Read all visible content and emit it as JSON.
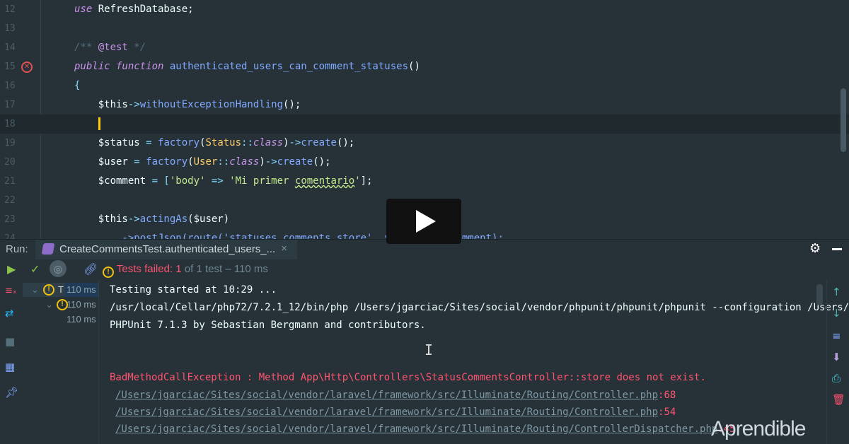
{
  "editor": {
    "lines": [
      {
        "n": "12",
        "tokens": [
          [
            "use ",
            "kw"
          ],
          [
            "RefreshDatabase;",
            "var"
          ]
        ]
      },
      {
        "n": "13",
        "tokens": []
      },
      {
        "n": "14",
        "tokens": [
          [
            "/** ",
            "cm"
          ],
          [
            "@test",
            "tag"
          ],
          [
            " */",
            "cm"
          ]
        ]
      },
      {
        "n": "15",
        "tokens": [
          [
            "public function ",
            "kw"
          ],
          [
            "authenticated_users_can_comment_statuses",
            "fn"
          ],
          [
            "()",
            "var"
          ]
        ]
      },
      {
        "n": "16",
        "tokens": [
          [
            "{",
            "op"
          ]
        ]
      },
      {
        "n": "17",
        "tokens": [
          [
            "    $this",
            "var"
          ],
          [
            "->",
            "op"
          ],
          [
            "withoutExceptionHandling",
            "fn"
          ],
          [
            "();",
            "var"
          ]
        ]
      },
      {
        "n": "18",
        "tokens": [
          [
            "    ",
            "var"
          ]
        ],
        "caret": true
      },
      {
        "n": "19",
        "tokens": [
          [
            "    $status ",
            "var"
          ],
          [
            "= ",
            "op"
          ],
          [
            "factory",
            "fn"
          ],
          [
            "(",
            "var"
          ],
          [
            "Status",
            "cls"
          ],
          [
            "::",
            "op"
          ],
          [
            "class",
            "it"
          ],
          [
            ")",
            "var"
          ],
          [
            "->",
            "op"
          ],
          [
            "create",
            "fn"
          ],
          [
            "();",
            "var"
          ]
        ]
      },
      {
        "n": "20",
        "tokens": [
          [
            "    $user ",
            "var"
          ],
          [
            "= ",
            "op"
          ],
          [
            "factory",
            "fn"
          ],
          [
            "(",
            "var"
          ],
          [
            "User",
            "cls"
          ],
          [
            "::",
            "op"
          ],
          [
            "class",
            "it"
          ],
          [
            ")",
            "var"
          ],
          [
            "->",
            "op"
          ],
          [
            "create",
            "fn"
          ],
          [
            "();",
            "var"
          ]
        ]
      },
      {
        "n": "21",
        "tokens": [
          [
            "    $comment ",
            "var"
          ],
          [
            "= [",
            "op"
          ],
          [
            "'body'",
            "str"
          ],
          [
            " => ",
            "op"
          ],
          [
            "'Mi primer ",
            "str"
          ],
          [
            "comentario",
            "str sq"
          ],
          [
            "'",
            "str"
          ],
          [
            "];",
            "var"
          ]
        ]
      },
      {
        "n": "22",
        "tokens": []
      },
      {
        "n": "23",
        "tokens": [
          [
            "    $this",
            "var"
          ],
          [
            "->",
            "op"
          ],
          [
            "actingAs",
            "fn"
          ],
          [
            "($user)",
            "var"
          ]
        ]
      },
      {
        "n": "24",
        "tokens": [
          [
            "        ->postJson(route('statuses.comments.store', $status), $comment);",
            "fn"
          ]
        ]
      }
    ]
  },
  "run": {
    "label": "Run:",
    "tab": "CreateCommentsTest.authenticated_users_...",
    "close": "×",
    "status_failed": "Tests failed: 1",
    "status_rest": " of 1 test – 110 ms"
  },
  "tree": [
    {
      "label": "T",
      "time": "110 ms"
    },
    {
      "label": "",
      "time": "110 ms"
    },
    {
      "label": "",
      "time": "110 ms"
    }
  ],
  "console": {
    "lines": [
      "Testing started at 10:29 ...",
      "/usr/local/Cellar/php72/7.2.1_12/bin/php /Users/jgarciac/Sites/social/vendor/phpunit/phpunit/phpunit --configuration /Users/",
      "PHPUnit 7.1.3 by Sebastian Bergmann and contributors."
    ],
    "error": "BadMethodCallException : Method App\\Http\\Controllers\\StatusCommentsController::store does not exist.",
    "trace": [
      {
        "path": "/Users/jgarciac/Sites/social/vendor/laravel/framework/src/Illuminate/Routing/Controller.php",
        "line": ":68"
      },
      {
        "path": "/Users/jgarciac/Sites/social/vendor/laravel/framework/src/Illuminate/Routing/Controller.php",
        "line": ":54"
      },
      {
        "path": "/Users/jgarciac/Sites/social/vendor/laravel/framework/src/Illuminate/Routing/ControllerDispatcher.php",
        "line": ":45"
      }
    ]
  },
  "watermark": {
    "pre": "Apren",
    "bold": "dible"
  }
}
